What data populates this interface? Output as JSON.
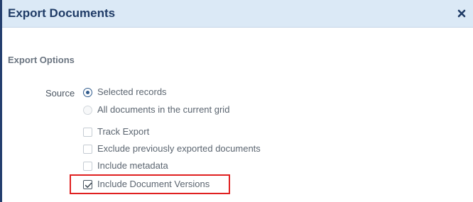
{
  "dialog": {
    "title": "Export Documents",
    "close_icon": "close-icon"
  },
  "section": {
    "title": "Export Options"
  },
  "source": {
    "label": "Source",
    "options": [
      {
        "label": "Selected records",
        "selected": true,
        "enabled": true
      },
      {
        "label": "All documents in the current grid",
        "selected": false,
        "enabled": false
      }
    ]
  },
  "checkboxes": [
    {
      "label": "Track Export",
      "checked": false
    },
    {
      "label": "Exclude previously exported documents",
      "checked": false
    },
    {
      "label": "Include metadata",
      "checked": false
    },
    {
      "label": "Include Document Versions",
      "checked": true
    }
  ],
  "colors": {
    "title_bar": "#dbe9f6",
    "title_text": "#1f3b66",
    "highlight": "#e02020"
  }
}
